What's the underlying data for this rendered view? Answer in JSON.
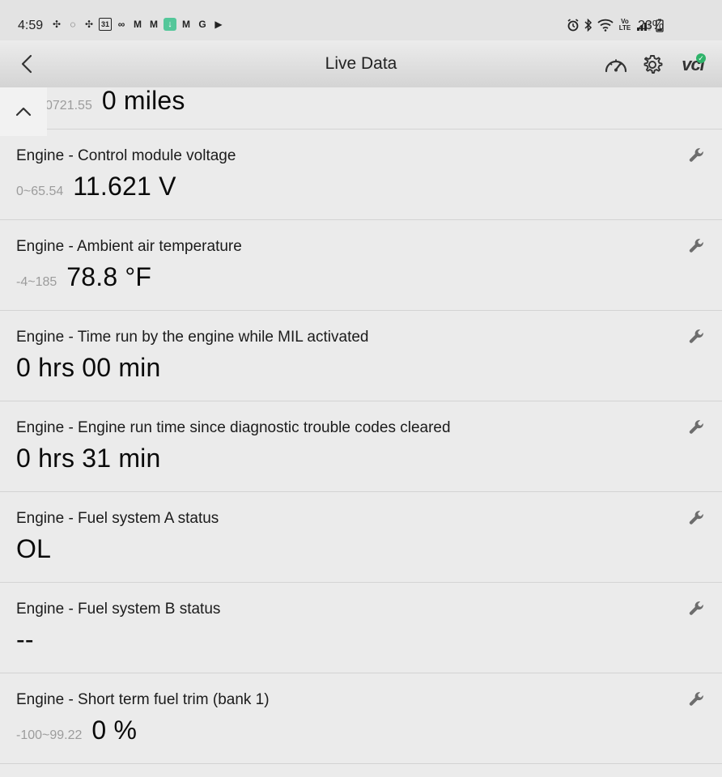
{
  "status_bar": {
    "time": "4:59",
    "battery": "23%",
    "vo_lte": "Vo LTE"
  },
  "header": {
    "title": "Live Data",
    "vci_label": "vci"
  },
  "partial_item": {
    "range": "0721.55",
    "value": "0 miles"
  },
  "items": [
    {
      "label": "Engine - Control module voltage",
      "range": "0~65.54",
      "value": "11.621 V"
    },
    {
      "label": "Engine - Ambient air temperature",
      "range": "-4~185",
      "value": "78.8 °F"
    },
    {
      "label": "Engine - Time run by the engine while MIL activated",
      "range": "",
      "value": "0 hrs 00 min"
    },
    {
      "label": "Engine - Engine run time since diagnostic trouble codes cleared",
      "range": "",
      "value": "0 hrs 31 min"
    },
    {
      "label": "Engine - Fuel system A status",
      "range": "",
      "value": "OL"
    },
    {
      "label": "Engine - Fuel system B status",
      "range": "",
      "value": "--"
    },
    {
      "label": "Engine - Short term fuel trim (bank 1)",
      "range": "-100~99.22",
      "value": "0 %"
    }
  ]
}
